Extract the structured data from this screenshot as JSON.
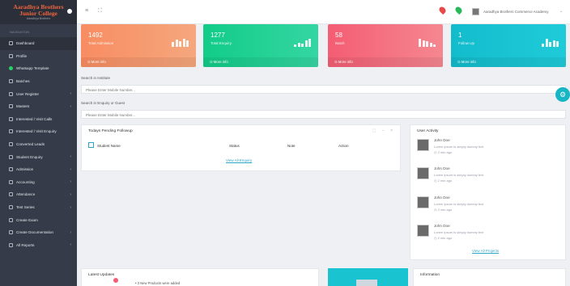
{
  "sidebar": {
    "brand": {
      "line1": "Aaradhya Brothers",
      "line2": "Junior College",
      "line3": "Aaradhya Brothers"
    },
    "section_header": "NAVIGATION",
    "items": [
      {
        "label": "Dashboard",
        "arrow": ""
      },
      {
        "label": "Profile",
        "arrow": ""
      },
      {
        "label": "Whatsapp Template",
        "arrow": ""
      },
      {
        "label": "Batches",
        "arrow": ""
      },
      {
        "label": "User Register",
        "arrow": "›"
      },
      {
        "label": "Masters",
        "arrow": "›"
      },
      {
        "label": "Interested / Visit Calls",
        "arrow": ""
      },
      {
        "label": "Interested / Visit Enquiry",
        "arrow": ""
      },
      {
        "label": "Converted Leads",
        "arrow": ""
      },
      {
        "label": "Student Enquiry",
        "arrow": "›"
      },
      {
        "label": "Admission",
        "arrow": "›"
      },
      {
        "label": "Accounting",
        "arrow": "›"
      },
      {
        "label": "Attendance",
        "arrow": "›"
      },
      {
        "label": "Test Series",
        "arrow": "›"
      },
      {
        "label": "Create Exam",
        "arrow": ""
      },
      {
        "label": "Create Documentation",
        "arrow": "›"
      },
      {
        "label": "All Reports",
        "arrow": "›"
      }
    ]
  },
  "topbar": {
    "menu_icon": "≡",
    "fullscreen_icon": "⛶",
    "user_name": "Aaradhya Brothers Commerce Academy",
    "caret": "⌄"
  },
  "stats": [
    {
      "value": "1492",
      "label": "Total Admission",
      "more": "More info",
      "bars": [
        6,
        9,
        7,
        10,
        8
      ]
    },
    {
      "value": "1277",
      "label": "Total Enquiry",
      "more": "More info",
      "bars": [
        3,
        5,
        4,
        8,
        10
      ]
    },
    {
      "value": "58",
      "label": "Batch",
      "more": "More info",
      "bars": [
        10,
        8,
        7,
        5,
        3
      ]
    },
    {
      "value": "1",
      "label": "Follow Up",
      "more": "More info",
      "bars": [
        4,
        10,
        6,
        8,
        7
      ]
    }
  ],
  "search_institute": {
    "label": "Search in Institute",
    "placeholder": "Please Enter Mobile Number..."
  },
  "search_enquiry": {
    "label": "Search in Enquiry or Guest",
    "placeholder": "Please Enter Mobile Number..."
  },
  "followups": {
    "title": "Todays Pending Followup",
    "columns": [
      "Student Name",
      "Status",
      "Note",
      "Action"
    ],
    "view_all": "View All Enquiry"
  },
  "activity": {
    "title": "User Activity",
    "entries": [
      {
        "name": "John Doe",
        "text": "Lorem ipsum is simply dummy text",
        "time": "2 min ago"
      },
      {
        "name": "John Doe",
        "text": "Lorem ipsum is simply dummy text",
        "time": "2 min ago"
      },
      {
        "name": "John Doe",
        "text": "Lorem ipsum is simply dummy text",
        "time": "2 min ago"
      },
      {
        "name": "John Doe",
        "text": "Lorem ipsum is simply dummy text",
        "time": "2 min ago"
      }
    ],
    "view_all": "View All Projects"
  },
  "updates": {
    "title": "Latest Updates",
    "text": "• 3 New Products were added"
  },
  "information": {
    "title": "Information"
  },
  "colors": {
    "orange": "#f88c62",
    "green": "#12cc88",
    "red": "#f45d73",
    "teal": "#13bccc",
    "sidebar": "#353b48"
  }
}
